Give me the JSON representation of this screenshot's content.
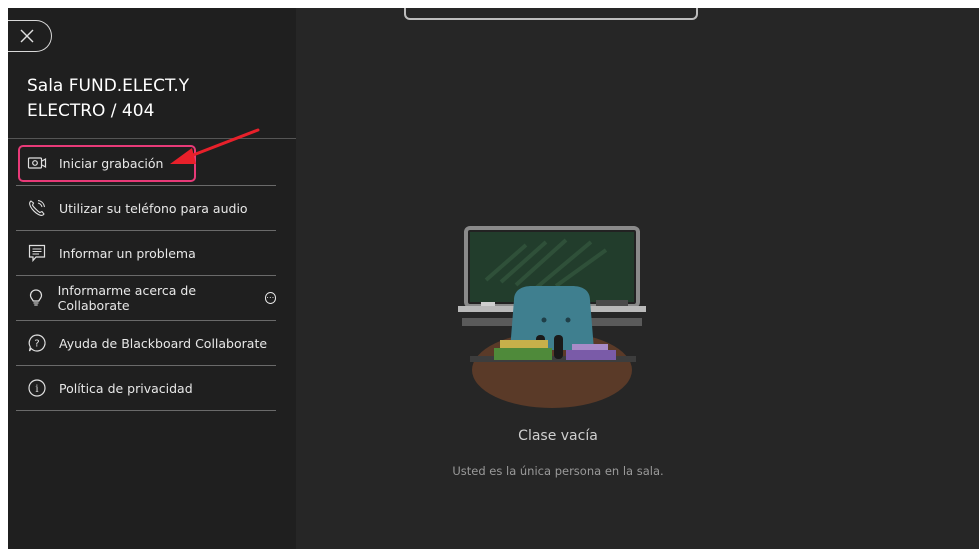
{
  "sidebar": {
    "room_title": "Sala FUND.ELECT.Y ELECTRO / 404",
    "items": [
      {
        "label": "Iniciar grabación",
        "icon": "record-camera-icon"
      },
      {
        "label": "Utilizar su teléfono para audio",
        "icon": "phone-icon"
      },
      {
        "label": "Informar un problema",
        "icon": "report-icon"
      },
      {
        "label": "Informarme acerca de Collaborate",
        "icon": "lightbulb-icon"
      },
      {
        "label": "Ayuda de Blackboard Collaborate",
        "icon": "help-icon"
      },
      {
        "label": "Política de privacidad",
        "icon": "info-icon"
      }
    ]
  },
  "main": {
    "empty_title": "Clase vacía",
    "empty_subtitle": "Usted es la única persona en la sala."
  },
  "colors": {
    "sidebar_bg": "#1f1f1f",
    "main_bg": "#262626",
    "highlight": "#e83a78",
    "arrow": "#e8202a"
  }
}
